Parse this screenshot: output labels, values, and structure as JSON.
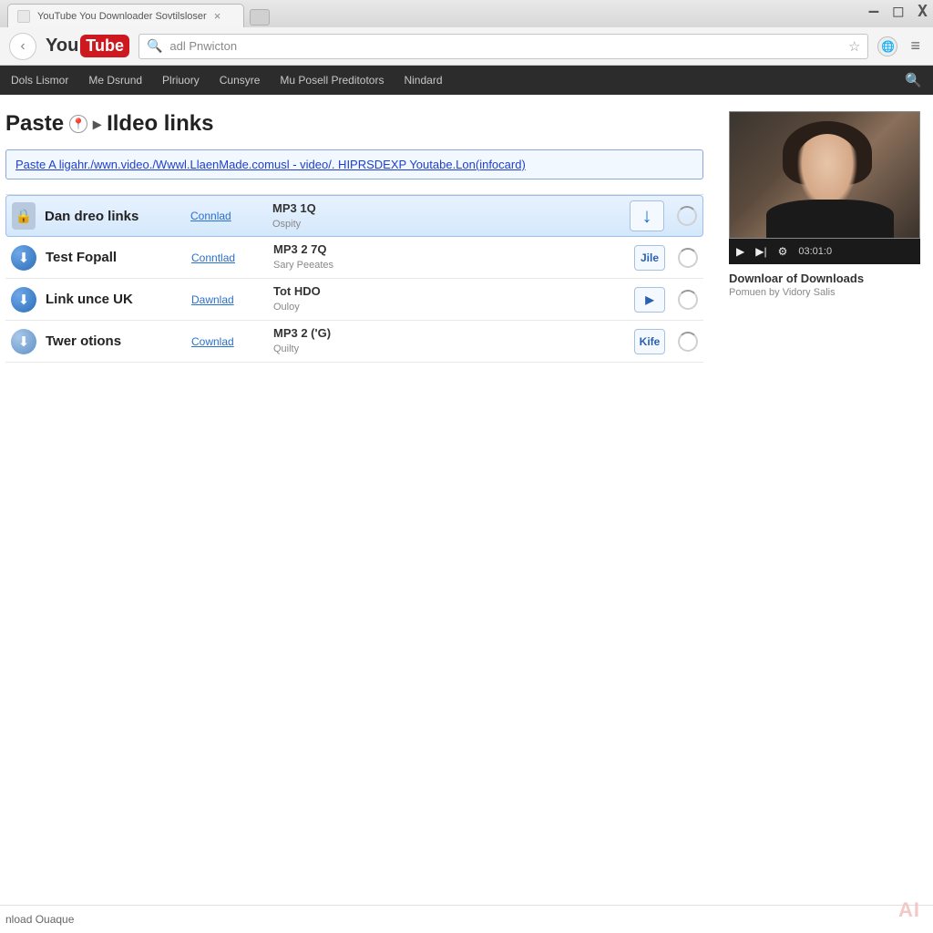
{
  "browser": {
    "tab_title": "YouTube You Downloader Sovtilsloser",
    "address_placeholder": "adl Pnwicton",
    "win": {
      "min": "—",
      "max": "□",
      "close": "X"
    },
    "logo": {
      "you": "You",
      "tube": "Tube"
    }
  },
  "darknav": {
    "items": [
      "Dols Lismor",
      "Me Dsrund",
      "Plriuory",
      "Cunsyre",
      "Mu Posell Preditotors",
      "Nindard"
    ]
  },
  "page": {
    "heading_prefix": "Paste",
    "heading_suffix": "Ildeo links",
    "paste_link_text": "Paste A ligahr./wwn.video./Wwwl.LlaenMade.comusl - video/. HIPRSDEXP Youtabe.Lon(infocard)"
  },
  "rows": [
    {
      "title": "Dan dreo links",
      "link": "Connlad",
      "fmt": "MP3 1Q",
      "sub": "Ospity",
      "action": "↓",
      "action_kind": "bigarrow"
    },
    {
      "title": "Test Fopall",
      "link": "Conntlad",
      "fmt": "MP3 2 7Q",
      "sub": "Sary Peeates",
      "action": "Jile",
      "action_kind": "text"
    },
    {
      "title": "Link unce UK",
      "link": "Dawnlad",
      "fmt": "Tot HDO",
      "sub": "Ouloy",
      "action": "▶",
      "action_kind": "play"
    },
    {
      "title": "Twer otions",
      "link": "Cownlad",
      "fmt": "MP3 2 ('G)",
      "sub": "Quilty",
      "action": "Kife",
      "action_kind": "text"
    }
  ],
  "preview": {
    "player_time": "03:01:0",
    "title": "Downloar of Downloads",
    "subtitle": "Pomuen by Vidory Salis"
  },
  "footer": {
    "text": "nload Ouaque"
  },
  "watermark": "AI"
}
